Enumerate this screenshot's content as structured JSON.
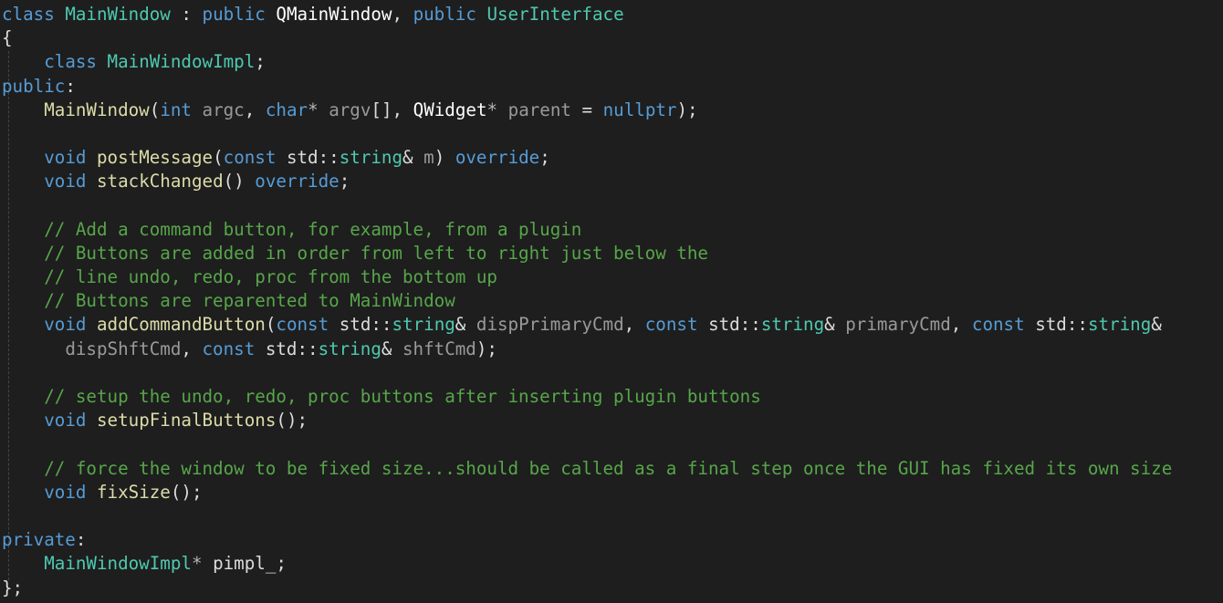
{
  "colors": {
    "background": "#1e1e1e",
    "plain": "#dcdcdc",
    "keyword": "#569cd6",
    "type": "#4ec9b0",
    "function": "#dcdcaa",
    "comment": "#57a64a",
    "parameter": "#9a9a9a",
    "type_white": "#ffffff",
    "operator": "#b4b4b4"
  },
  "code_lines": [
    [
      {
        "t": "class",
        "c": "keyword"
      },
      {
        "t": " ",
        "c": "plain"
      },
      {
        "t": "MainWindow",
        "c": "type"
      },
      {
        "t": " : ",
        "c": "plain"
      },
      {
        "t": "public",
        "c": "keyword"
      },
      {
        "t": " ",
        "c": "plain"
      },
      {
        "t": "QMainWindow",
        "c": "type_white"
      },
      {
        "t": ", ",
        "c": "plain"
      },
      {
        "t": "public",
        "c": "keyword"
      },
      {
        "t": " ",
        "c": "plain"
      },
      {
        "t": "UserInterface",
        "c": "type"
      }
    ],
    [
      {
        "t": "{",
        "c": "plain"
      }
    ],
    [
      {
        "t": "    ",
        "c": "plain"
      },
      {
        "t": "class",
        "c": "keyword"
      },
      {
        "t": " ",
        "c": "plain"
      },
      {
        "t": "MainWindowImpl",
        "c": "type"
      },
      {
        "t": ";",
        "c": "plain"
      }
    ],
    [
      {
        "t": "public",
        "c": "keyword"
      },
      {
        "t": ":",
        "c": "plain"
      }
    ],
    [
      {
        "t": "    ",
        "c": "plain"
      },
      {
        "t": "MainWindow",
        "c": "function"
      },
      {
        "t": "(",
        "c": "plain"
      },
      {
        "t": "int",
        "c": "keyword"
      },
      {
        "t": " ",
        "c": "plain"
      },
      {
        "t": "argc",
        "c": "parameter"
      },
      {
        "t": ", ",
        "c": "plain"
      },
      {
        "t": "char",
        "c": "keyword"
      },
      {
        "t": "*",
        "c": "operator"
      },
      {
        "t": " ",
        "c": "plain"
      },
      {
        "t": "argv",
        "c": "parameter"
      },
      {
        "t": "[], ",
        "c": "plain"
      },
      {
        "t": "QWidget",
        "c": "type_white"
      },
      {
        "t": "*",
        "c": "operator"
      },
      {
        "t": " ",
        "c": "plain"
      },
      {
        "t": "parent",
        "c": "parameter"
      },
      {
        "t": " = ",
        "c": "plain"
      },
      {
        "t": "nullptr",
        "c": "keyword"
      },
      {
        "t": ");",
        "c": "plain"
      }
    ],
    [],
    [
      {
        "t": "    ",
        "c": "plain"
      },
      {
        "t": "void",
        "c": "keyword"
      },
      {
        "t": " ",
        "c": "plain"
      },
      {
        "t": "postMessage",
        "c": "function"
      },
      {
        "t": "(",
        "c": "plain"
      },
      {
        "t": "const",
        "c": "keyword"
      },
      {
        "t": " std::",
        "c": "plain"
      },
      {
        "t": "string",
        "c": "type"
      },
      {
        "t": "& ",
        "c": "plain"
      },
      {
        "t": "m",
        "c": "parameter"
      },
      {
        "t": ") ",
        "c": "plain"
      },
      {
        "t": "override",
        "c": "keyword"
      },
      {
        "t": ";",
        "c": "plain"
      }
    ],
    [
      {
        "t": "    ",
        "c": "plain"
      },
      {
        "t": "void",
        "c": "keyword"
      },
      {
        "t": " ",
        "c": "plain"
      },
      {
        "t": "stackChanged",
        "c": "function"
      },
      {
        "t": "() ",
        "c": "plain"
      },
      {
        "t": "override",
        "c": "keyword"
      },
      {
        "t": ";",
        "c": "plain"
      }
    ],
    [],
    [
      {
        "t": "    ",
        "c": "plain"
      },
      {
        "t": "// Add a command button, for example, from a plugin",
        "c": "comment"
      }
    ],
    [
      {
        "t": "    ",
        "c": "plain"
      },
      {
        "t": "// Buttons are added in order from left to right just below the",
        "c": "comment"
      }
    ],
    [
      {
        "t": "    ",
        "c": "plain"
      },
      {
        "t": "// line undo, redo, proc from the bottom up",
        "c": "comment"
      }
    ],
    [
      {
        "t": "    ",
        "c": "plain"
      },
      {
        "t": "// Buttons are reparented to MainWindow",
        "c": "comment"
      }
    ],
    [
      {
        "t": "    ",
        "c": "plain"
      },
      {
        "t": "void",
        "c": "keyword"
      },
      {
        "t": " ",
        "c": "plain"
      },
      {
        "t": "addCommandButton",
        "c": "function"
      },
      {
        "t": "(",
        "c": "plain"
      },
      {
        "t": "const",
        "c": "keyword"
      },
      {
        "t": " std::",
        "c": "plain"
      },
      {
        "t": "string",
        "c": "type"
      },
      {
        "t": "& ",
        "c": "plain"
      },
      {
        "t": "dispPrimaryCmd",
        "c": "parameter"
      },
      {
        "t": ", ",
        "c": "plain"
      },
      {
        "t": "const",
        "c": "keyword"
      },
      {
        "t": " std::",
        "c": "plain"
      },
      {
        "t": "string",
        "c": "type"
      },
      {
        "t": "& ",
        "c": "plain"
      },
      {
        "t": "primaryCmd",
        "c": "parameter"
      },
      {
        "t": ", ",
        "c": "plain"
      },
      {
        "t": "const",
        "c": "keyword"
      },
      {
        "t": " std::",
        "c": "plain"
      },
      {
        "t": "string",
        "c": "type"
      },
      {
        "t": "&",
        "c": "plain"
      }
    ],
    [
      {
        "t": "      ",
        "c": "plain"
      },
      {
        "t": "dispShftCmd",
        "c": "parameter"
      },
      {
        "t": ", ",
        "c": "plain"
      },
      {
        "t": "const",
        "c": "keyword"
      },
      {
        "t": " std::",
        "c": "plain"
      },
      {
        "t": "string",
        "c": "type"
      },
      {
        "t": "& ",
        "c": "plain"
      },
      {
        "t": "shftCmd",
        "c": "parameter"
      },
      {
        "t": ");",
        "c": "plain"
      }
    ],
    [],
    [
      {
        "t": "    ",
        "c": "plain"
      },
      {
        "t": "// setup the undo, redo, proc buttons after inserting plugin buttons",
        "c": "comment"
      }
    ],
    [
      {
        "t": "    ",
        "c": "plain"
      },
      {
        "t": "void",
        "c": "keyword"
      },
      {
        "t": " ",
        "c": "plain"
      },
      {
        "t": "setupFinalButtons",
        "c": "function"
      },
      {
        "t": "();",
        "c": "plain"
      }
    ],
    [],
    [
      {
        "t": "    ",
        "c": "plain"
      },
      {
        "t": "// force the window to be fixed size...should be called as a final step once the GUI has fixed its own size",
        "c": "comment"
      }
    ],
    [
      {
        "t": "    ",
        "c": "plain"
      },
      {
        "t": "void",
        "c": "keyword"
      },
      {
        "t": " ",
        "c": "plain"
      },
      {
        "t": "fixSize",
        "c": "function"
      },
      {
        "t": "();",
        "c": "plain"
      }
    ],
    [],
    [
      {
        "t": "private",
        "c": "keyword"
      },
      {
        "t": ":",
        "c": "plain"
      }
    ],
    [
      {
        "t": "    ",
        "c": "plain"
      },
      {
        "t": "MainWindowImpl",
        "c": "type"
      },
      {
        "t": "*",
        "c": "operator"
      },
      {
        "t": " ",
        "c": "plain"
      },
      {
        "t": "pimpl_",
        "c": "plain"
      },
      {
        "t": ";",
        "c": "plain"
      }
    ],
    [
      {
        "t": "};",
        "c": "plain"
      }
    ]
  ]
}
